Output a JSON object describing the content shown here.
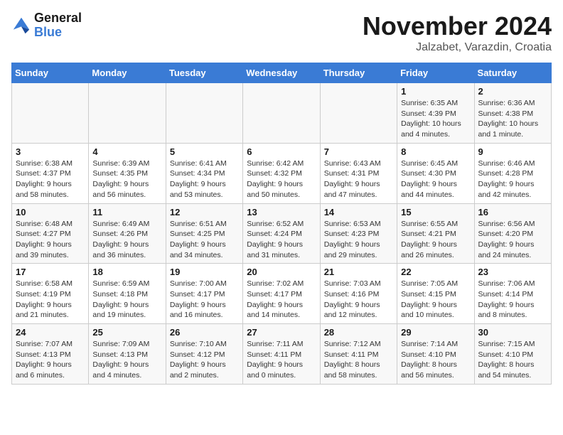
{
  "logo": {
    "line1": "General",
    "line2": "Blue"
  },
  "title": "November 2024",
  "subtitle": "Jalzabet, Varazdin, Croatia",
  "weekdays": [
    "Sunday",
    "Monday",
    "Tuesday",
    "Wednesday",
    "Thursday",
    "Friday",
    "Saturday"
  ],
  "weeks": [
    [
      {
        "day": "",
        "info": ""
      },
      {
        "day": "",
        "info": ""
      },
      {
        "day": "",
        "info": ""
      },
      {
        "day": "",
        "info": ""
      },
      {
        "day": "",
        "info": ""
      },
      {
        "day": "1",
        "info": "Sunrise: 6:35 AM\nSunset: 4:39 PM\nDaylight: 10 hours\nand 4 minutes."
      },
      {
        "day": "2",
        "info": "Sunrise: 6:36 AM\nSunset: 4:38 PM\nDaylight: 10 hours\nand 1 minute."
      }
    ],
    [
      {
        "day": "3",
        "info": "Sunrise: 6:38 AM\nSunset: 4:37 PM\nDaylight: 9 hours\nand 58 minutes."
      },
      {
        "day": "4",
        "info": "Sunrise: 6:39 AM\nSunset: 4:35 PM\nDaylight: 9 hours\nand 56 minutes."
      },
      {
        "day": "5",
        "info": "Sunrise: 6:41 AM\nSunset: 4:34 PM\nDaylight: 9 hours\nand 53 minutes."
      },
      {
        "day": "6",
        "info": "Sunrise: 6:42 AM\nSunset: 4:32 PM\nDaylight: 9 hours\nand 50 minutes."
      },
      {
        "day": "7",
        "info": "Sunrise: 6:43 AM\nSunset: 4:31 PM\nDaylight: 9 hours\nand 47 minutes."
      },
      {
        "day": "8",
        "info": "Sunrise: 6:45 AM\nSunset: 4:30 PM\nDaylight: 9 hours\nand 44 minutes."
      },
      {
        "day": "9",
        "info": "Sunrise: 6:46 AM\nSunset: 4:28 PM\nDaylight: 9 hours\nand 42 minutes."
      }
    ],
    [
      {
        "day": "10",
        "info": "Sunrise: 6:48 AM\nSunset: 4:27 PM\nDaylight: 9 hours\nand 39 minutes."
      },
      {
        "day": "11",
        "info": "Sunrise: 6:49 AM\nSunset: 4:26 PM\nDaylight: 9 hours\nand 36 minutes."
      },
      {
        "day": "12",
        "info": "Sunrise: 6:51 AM\nSunset: 4:25 PM\nDaylight: 9 hours\nand 34 minutes."
      },
      {
        "day": "13",
        "info": "Sunrise: 6:52 AM\nSunset: 4:24 PM\nDaylight: 9 hours\nand 31 minutes."
      },
      {
        "day": "14",
        "info": "Sunrise: 6:53 AM\nSunset: 4:23 PM\nDaylight: 9 hours\nand 29 minutes."
      },
      {
        "day": "15",
        "info": "Sunrise: 6:55 AM\nSunset: 4:21 PM\nDaylight: 9 hours\nand 26 minutes."
      },
      {
        "day": "16",
        "info": "Sunrise: 6:56 AM\nSunset: 4:20 PM\nDaylight: 9 hours\nand 24 minutes."
      }
    ],
    [
      {
        "day": "17",
        "info": "Sunrise: 6:58 AM\nSunset: 4:19 PM\nDaylight: 9 hours\nand 21 minutes."
      },
      {
        "day": "18",
        "info": "Sunrise: 6:59 AM\nSunset: 4:18 PM\nDaylight: 9 hours\nand 19 minutes."
      },
      {
        "day": "19",
        "info": "Sunrise: 7:00 AM\nSunset: 4:17 PM\nDaylight: 9 hours\nand 16 minutes."
      },
      {
        "day": "20",
        "info": "Sunrise: 7:02 AM\nSunset: 4:17 PM\nDaylight: 9 hours\nand 14 minutes."
      },
      {
        "day": "21",
        "info": "Sunrise: 7:03 AM\nSunset: 4:16 PM\nDaylight: 9 hours\nand 12 minutes."
      },
      {
        "day": "22",
        "info": "Sunrise: 7:05 AM\nSunset: 4:15 PM\nDaylight: 9 hours\nand 10 minutes."
      },
      {
        "day": "23",
        "info": "Sunrise: 7:06 AM\nSunset: 4:14 PM\nDaylight: 9 hours\nand 8 minutes."
      }
    ],
    [
      {
        "day": "24",
        "info": "Sunrise: 7:07 AM\nSunset: 4:13 PM\nDaylight: 9 hours\nand 6 minutes."
      },
      {
        "day": "25",
        "info": "Sunrise: 7:09 AM\nSunset: 4:13 PM\nDaylight: 9 hours\nand 4 minutes."
      },
      {
        "day": "26",
        "info": "Sunrise: 7:10 AM\nSunset: 4:12 PM\nDaylight: 9 hours\nand 2 minutes."
      },
      {
        "day": "27",
        "info": "Sunrise: 7:11 AM\nSunset: 4:11 PM\nDaylight: 9 hours\nand 0 minutes."
      },
      {
        "day": "28",
        "info": "Sunrise: 7:12 AM\nSunset: 4:11 PM\nDaylight: 8 hours\nand 58 minutes."
      },
      {
        "day": "29",
        "info": "Sunrise: 7:14 AM\nSunset: 4:10 PM\nDaylight: 8 hours\nand 56 minutes."
      },
      {
        "day": "30",
        "info": "Sunrise: 7:15 AM\nSunset: 4:10 PM\nDaylight: 8 hours\nand 54 minutes."
      }
    ]
  ]
}
